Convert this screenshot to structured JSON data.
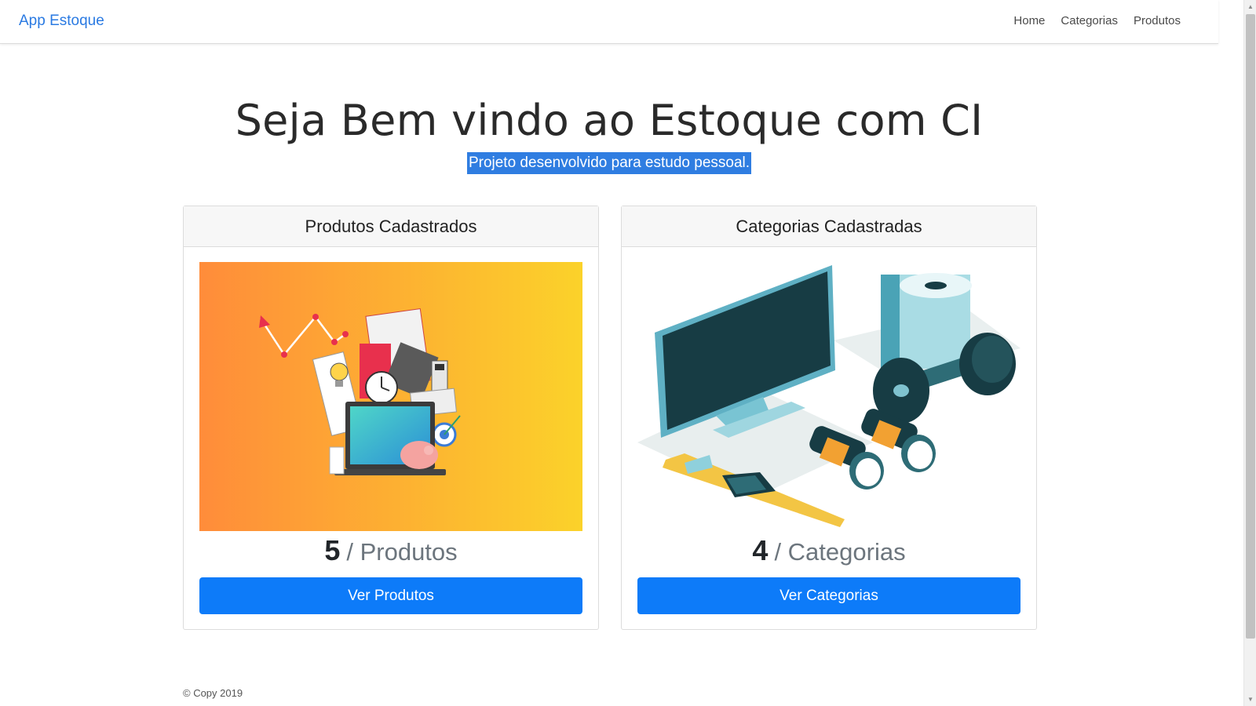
{
  "navbar": {
    "brand": "App Estoque",
    "links": [
      "Home",
      "Categorias",
      "Produtos"
    ]
  },
  "hero": {
    "title": "Seja Bem vindo ao Estoque com CI",
    "subtitle": "Projeto desenvolvido para estudo pessoal."
  },
  "cards": [
    {
      "header": "Produtos Cadastrados",
      "count": "5",
      "count_label": "/ Produtos",
      "button": "Ver Produtos",
      "image_icon": "office-supplies-illustration"
    },
    {
      "header": "Categorias Cadastradas",
      "count": "4",
      "count_label": "/ Categorias",
      "button": "Ver Categorias",
      "image_icon": "products-categories-illustration"
    }
  ],
  "footer": {
    "text": "© Copy 2019"
  },
  "colors": {
    "brand": "#2a7ae2",
    "primary_button": "#0d7bf9",
    "selection": "#2f7de1",
    "gradient_start": "#ff8c3a",
    "gradient_end": "#fbd22a"
  }
}
